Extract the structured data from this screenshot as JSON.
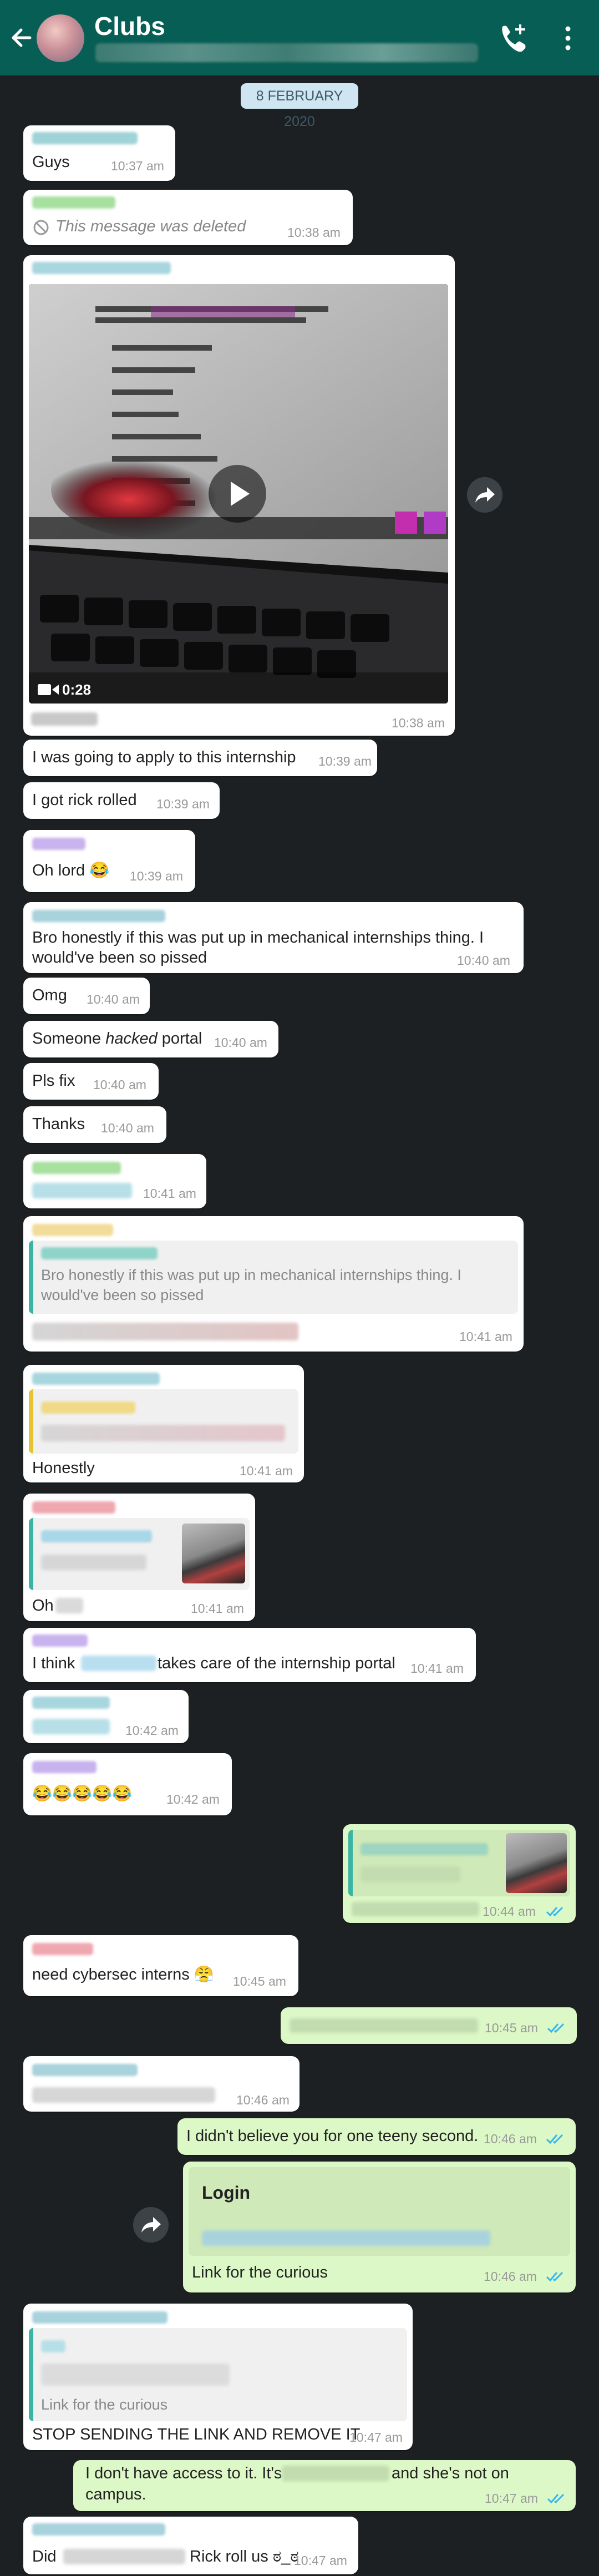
{
  "header": {
    "title": "Clubs",
    "back_icon": "arrow-left-icon",
    "call_icon": "add-call-icon",
    "menu_icon": "more-vert-icon"
  },
  "date_chip": "8 FEBRUARY 2020",
  "messages": {
    "m1": {
      "text": "Guys",
      "time": "10:37 am"
    },
    "m2": {
      "text": "This message was deleted",
      "time": "10:38 am"
    },
    "m3": {
      "duration": "0:28",
      "time": "10:38 am"
    },
    "m4": {
      "text": "I was going to apply to this internship",
      "time": "10:39 am"
    },
    "m5": {
      "text": "I got rick rolled",
      "time": "10:39 am"
    },
    "m6": {
      "text": "Oh lord 😂",
      "time": "10:39 am"
    },
    "m7": {
      "line1": "Bro honestly if this was put up in mechanical internships thing. I",
      "line2": "would've been so pissed",
      "time": "10:40 am"
    },
    "m8": {
      "text": "Omg",
      "time": "10:40 am"
    },
    "m9": {
      "pre": "Someone ",
      "em": "hacked",
      "post": " portal",
      "time": "10:40 am"
    },
    "m10": {
      "text": "Pls fix",
      "time": "10:40 am"
    },
    "m11": {
      "text": "Thanks",
      "time": "10:40 am"
    },
    "m12": {
      "time": "10:41 am"
    },
    "m13": {
      "quote_line1": "Bro honestly if this was put up in mechanical internships thing. I",
      "quote_line2": "would've been so pissed",
      "time": "10:41 am"
    },
    "m14": {
      "text": "Honestly",
      "time": "10:41 am"
    },
    "m15": {
      "text": "Oh",
      "time": "10:41 am"
    },
    "m16": {
      "pre": "I think",
      "post": "takes care of the internship portal",
      "time": "10:41 am"
    },
    "m17": {
      "time": "10:42 am"
    },
    "m18": {
      "text": "😂😂😂😂😂",
      "time": "10:42 am"
    },
    "m19": {
      "time": "10:44 am"
    },
    "m20": {
      "text": "need cybersec interns 😤",
      "time": "10:45 am"
    },
    "m21": {
      "time": "10:45 am"
    },
    "m22": {
      "time": "10:46 am"
    },
    "m23": {
      "text": "I didn't believe you for one teeny second.",
      "time": "10:46 am"
    },
    "m24": {
      "link_title": "Login",
      "text": "Link for the curious",
      "time": "10:46 am"
    },
    "m25": {
      "quote_text": "Link for the curious",
      "text": "STOP SENDING THE LINK AND REMOVE IT",
      "time": "10:47 am"
    },
    "m26": {
      "pre": "I don't have access to it. It's",
      "post": "and she's not on",
      "line2": "campus.",
      "time": "10:47 am"
    },
    "m27": {
      "pre": "Did",
      "post": "Rick roll us ಠ_ಠ",
      "time": "10:47 am"
    }
  },
  "colors": {
    "header": "#075e54",
    "chat_bg": "#1c2022",
    "incoming": "#ffffff",
    "outgoing": "#dcf8c6",
    "read_ticks": "#34b7f1"
  }
}
